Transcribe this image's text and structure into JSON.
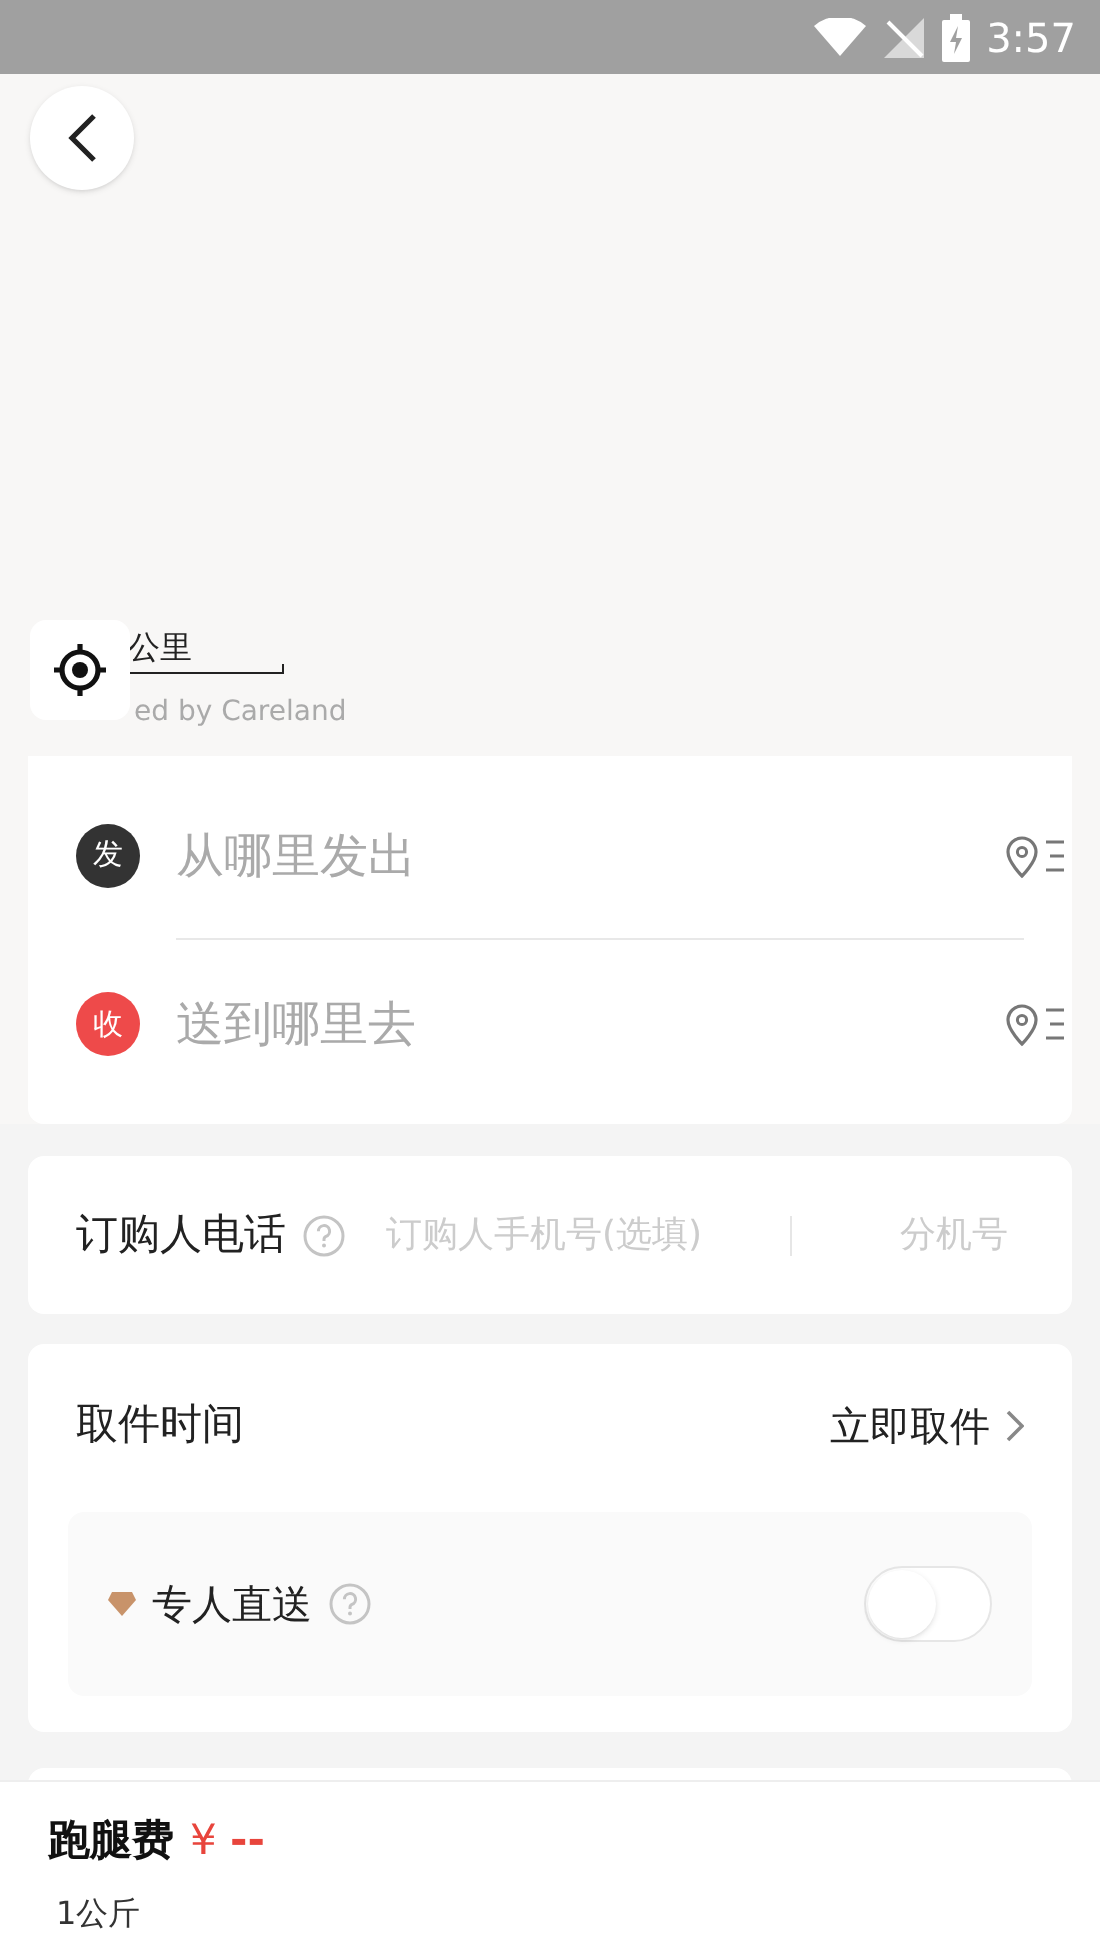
{
  "status_bar": {
    "time": "3:57"
  },
  "map": {
    "scale_label": "公里",
    "attribution": "ed by Careland"
  },
  "addresses": [
    {
      "badge": "发",
      "placeholder": "从哪里发出",
      "color": "#333333"
    },
    {
      "badge": "收",
      "placeholder": "送到哪里去",
      "color": "#ee4a4a"
    }
  ],
  "phone": {
    "label": "订购人电话",
    "placeholder": "订购人手机号(选填)",
    "extension_placeholder": "分机号"
  },
  "pickup": {
    "label": "取件时间",
    "value": "立即取件"
  },
  "direct_delivery": {
    "label": "专人直送",
    "on": false
  },
  "footer": {
    "fee_label": "跑腿费",
    "currency": "¥",
    "amount": "--",
    "weight": "1公斤"
  }
}
